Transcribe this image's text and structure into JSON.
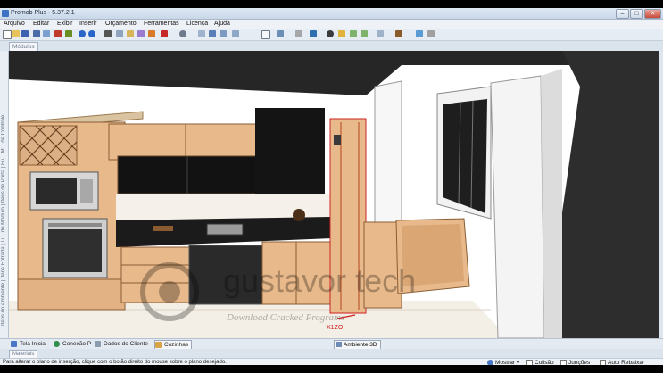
{
  "window": {
    "title": "Promob Plus - 5.37.2.1",
    "controls": [
      "–",
      "□",
      "✕"
    ]
  },
  "menu": [
    "Arquivo",
    "Editar",
    "Exibir",
    "Inserir",
    "Orçamento",
    "Ferramentas",
    "Licença",
    "Ajuda"
  ],
  "panels": {
    "top_tab": "Módulos",
    "left_strip_text": "Itens do Ambiente | Itens Entrada | Li... do Módulo | Itens de Porta | Fu... M... de Controle",
    "bottom_materials_tab": "Materiais"
  },
  "bottom_tabs": [
    "Tela Inicial",
    "Conexão P",
    "Dados do Cliente",
    "Cozinhas"
  ],
  "view_tab": "Ambiente 3D",
  "status": {
    "message": "Para alterar o plano de inserção, clique com o botão direito do mouse sobre o plano desejado.",
    "buttons": [
      "Mostrar",
      "Colisão",
      "Junções",
      "Auto Rebaixar"
    ],
    "mostrar_arrow": "▾"
  },
  "watermark": {
    "brand": "gustavor tech",
    "tagline": "Download Cracked Programs"
  },
  "scene": {
    "axis_label": "X1ZO",
    "colors": {
      "wood": "#e8b98a",
      "wood_dark": "#c98f5c",
      "black_panel": "#111111",
      "countertop": "#1b1b1b",
      "wall_back": "#2c2c2c",
      "floor": "#f1ede4"
    }
  }
}
